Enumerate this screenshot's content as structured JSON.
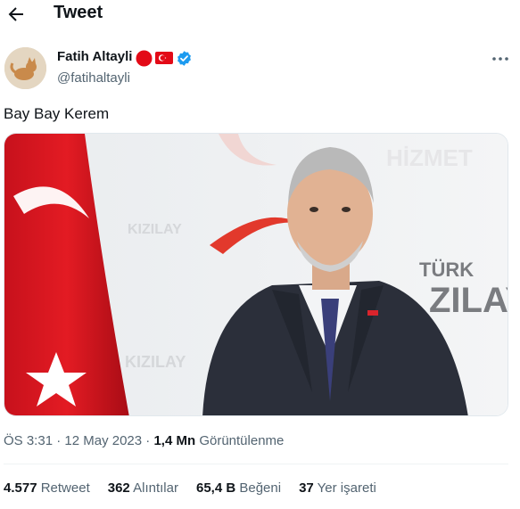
{
  "header": {
    "title": "Tweet"
  },
  "author": {
    "name": "Fatih Altayli",
    "handle": "@fatihaltayli",
    "badges": [
      "red-dot-icon",
      "turkish-flag-icon",
      "verified-icon"
    ]
  },
  "tweet": {
    "text": "Bay Bay Kerem",
    "media": {
      "description_icon": "photo",
      "watermark_hizmet": "HİZMET",
      "watermark_turk": "TÜRK",
      "watermark_kizilay_large": "ZILAY",
      "watermark_kizilay": "KIZILAY"
    }
  },
  "meta": {
    "time": "ÖS 3:31",
    "separator1": " · ",
    "date": "12 May 2023",
    "separator2": " · ",
    "views_count": "1,4 Mn",
    "views_label": "Görüntülenme"
  },
  "stats": [
    {
      "count": "4.577",
      "label": "Retweet"
    },
    {
      "count": "362",
      "label": "Alıntılar"
    },
    {
      "count": "65,4 B",
      "label": "Beğeni"
    },
    {
      "count": "37",
      "label": "Yer işareti"
    }
  ],
  "colors": {
    "verified": "#1d9bf0",
    "flag_red": "#e30a17",
    "text_secondary": "#536471"
  }
}
